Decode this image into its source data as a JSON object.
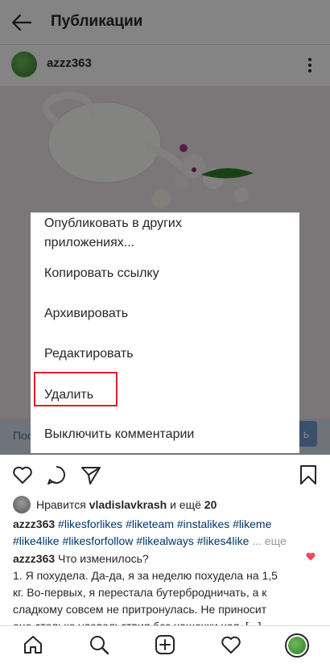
{
  "header": {
    "title": "Публикации"
  },
  "post": {
    "username": "azzz363",
    "promo_left": "Пос",
    "promo_right": "ь"
  },
  "menu": {
    "items": [
      "Опубликовать в других",
      "приложениях...",
      "Копировать ссылку",
      "Архивировать",
      "Редактировать",
      "Удалить",
      "Выключить комментарии"
    ]
  },
  "likes": {
    "prefix": "Нравится",
    "user": "vladislavkrash",
    "middle": "и ещё",
    "count": "20"
  },
  "caption": {
    "username": "azzz363",
    "line1": "#likesforlikes #liketeam #instalikes #likeme",
    "line2": "#like4like #likesforfollow #likealways #likes4like",
    "more": "... еще"
  },
  "comment": {
    "username": "azzz363",
    "first": "Что изменилось?",
    "line1": "1. Я похудела. Да-да, я за неделю похудела на 1,5",
    "line2": "кг. Во-первых, я перестала бутербродничать, а к",
    "line3": "сладкому совсем не притронулась. Не приносит",
    "line4": "оно столько удовольствия без чашечки чая. [...]"
  },
  "colors": {
    "accent": "#3f729b",
    "highlight": "#d9212b",
    "like": "#ed4956"
  }
}
